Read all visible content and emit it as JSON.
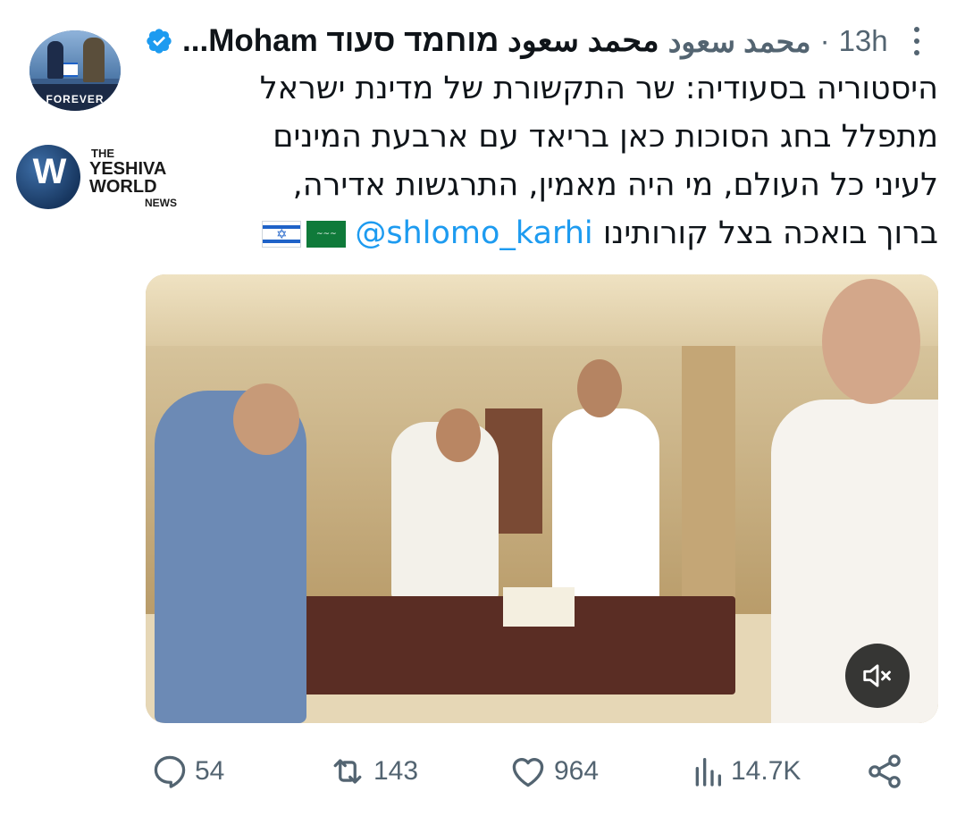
{
  "author": {
    "display_name": "محمد سعود מוחמד סעוד Moham...",
    "handle": "محمد سعود",
    "separator": "·",
    "time": "13h",
    "verified": true,
    "avatar_caption": "FOREVER"
  },
  "tweet": {
    "lines": [
      "היסטוריה בסעודיה: שר התקשורת של מדינת ישראל",
      "מתפלל בחג הסוכות כאן בריאד עם ארבעת המינים",
      "לעיני כל העולם, מי היה מאמין, התרגשות אדירה,",
      "ברוך בואכה בצל קורותינו"
    ],
    "mention": "@shlomo_karhi",
    "flags": [
      "israel-flag",
      "saudi-flag"
    ]
  },
  "watermark": {
    "letter": "W",
    "line1": "THE",
    "line2": "YESHIVA",
    "line3": "WORLD",
    "line4": "NEWS"
  },
  "media": {
    "type": "video",
    "muted": true
  },
  "actions": {
    "replies": "54",
    "reposts": "143",
    "likes": "964",
    "views": "14.7K"
  },
  "colors": {
    "accent": "#1d9bf0",
    "secondary_text": "#536471",
    "primary_text": "#0f1419"
  }
}
